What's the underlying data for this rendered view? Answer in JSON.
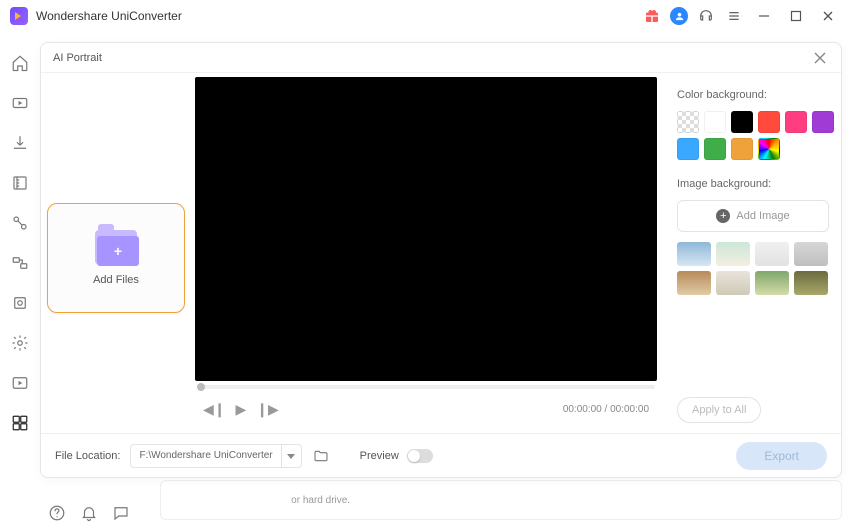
{
  "app": {
    "title": "Wondershare UniConverter"
  },
  "panel": {
    "title": "AI Portrait",
    "add_files_label": "Add Files",
    "time_display": "00:00:00 / 00:00:00",
    "file_location_label": "File Location:",
    "file_location_value": "F:\\Wondershare UniConverter",
    "preview_label": "Preview",
    "export_label": "Export"
  },
  "settings": {
    "color_bg_label": "Color background:",
    "image_bg_label": "Image background:",
    "add_image_label": "Add Image",
    "apply_all_label": "Apply to All",
    "swatches": [
      "transparent",
      "#ffffff",
      "#000000",
      "#ff4a3d",
      "#ff3e82",
      "#a03bd6",
      "#3aa8ff",
      "#3fae4a",
      "#f0a23a",
      "rainbow"
    ],
    "thumbs": [
      "linear-gradient(#8fb7d9,#d6e6f2)",
      "linear-gradient(#cde6d8,#f2efe0)",
      "linear-gradient(#f0f0f0,#e2e2e2)",
      "linear-gradient(#d7d7d7,#bfbfbf)",
      "linear-gradient(#b88a5a,#e0cba6)",
      "linear-gradient(#e8e4da,#cfc9b8)",
      "linear-gradient(#7fa66b,#d4dca8)",
      "linear-gradient(#6b6b3f,#a8a86b)"
    ]
  },
  "bg_peek": {
    "left_text": "or hard drive.",
    "mid_text": "",
    "right_text": ""
  }
}
